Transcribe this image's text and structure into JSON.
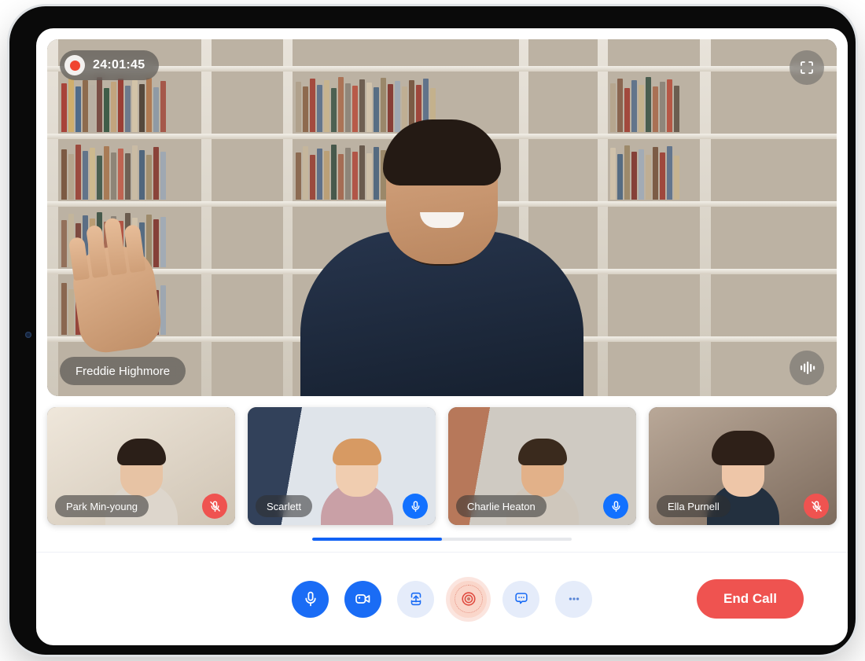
{
  "device": {
    "type": "tablet",
    "camera_icon": "front-camera-dot"
  },
  "stage": {
    "recording": {
      "time": "24:01:45",
      "indicator_icon": "record-dot-icon",
      "active": true
    },
    "fullscreen_icon": "fullscreen-expand-icon",
    "waveform_icon": "audio-waveform-icon",
    "speaker_name": "Freddie Highmore"
  },
  "participants": [
    {
      "name": "Park Min-young",
      "mic": "muted",
      "mic_icon": "microphone-muted-icon",
      "skin": "#e7c3a4",
      "hair": "#2b1f18",
      "top": "#ddd6cc",
      "bg1": "#efe7db",
      "bg2": "#cfc4b4"
    },
    {
      "name": "Scarlett",
      "mic": "unmuted",
      "mic_icon": "microphone-active-icon",
      "skin": "#f0cdb0",
      "hair": "#d79a63",
      "top": "#c9a0a6",
      "bg1": "#dfe4ea",
      "bg2": "#32415a"
    },
    {
      "name": "Charlie Heaton",
      "mic": "unmuted",
      "mic_icon": "microphone-active-icon",
      "skin": "#e2b189",
      "hair": "#3a2a1d",
      "top": "#cfc7bc",
      "bg1": "#b7785a",
      "bg2": "#cfcac2"
    },
    {
      "name": "Ella Purnell",
      "mic": "muted",
      "mic_icon": "microphone-muted-icon",
      "skin": "#eec6a8",
      "hair": "#2e2018",
      "top": "#23303f",
      "bg1": "#b9a898",
      "bg2": "#7d6b5d"
    }
  ],
  "scroll": {
    "progress_percent": 50
  },
  "controls": {
    "buttons": [
      {
        "name": "microphone",
        "icon": "microphone-icon",
        "style": "primary",
        "label": "Microphone"
      },
      {
        "name": "camera",
        "icon": "video-camera-icon",
        "style": "primary",
        "label": "Camera"
      },
      {
        "name": "share",
        "icon": "share-upload-icon",
        "style": "soft",
        "label": "Share Screen"
      },
      {
        "name": "record",
        "icon": "record-target-icon",
        "style": "record",
        "label": "Record"
      },
      {
        "name": "chat",
        "icon": "chat-bubble-icon",
        "style": "soft",
        "label": "Chat"
      },
      {
        "name": "more",
        "icon": "more-dots-icon",
        "style": "soft",
        "label": "More Options"
      }
    ],
    "end_call_label": "End Call"
  },
  "colors": {
    "accent_blue": "#1a6cf5",
    "soft_blue": "#e5ecfa",
    "danger_red": "#ef5350",
    "record_pink": "#fad6ca",
    "scroll_blue": "#1162f5"
  }
}
